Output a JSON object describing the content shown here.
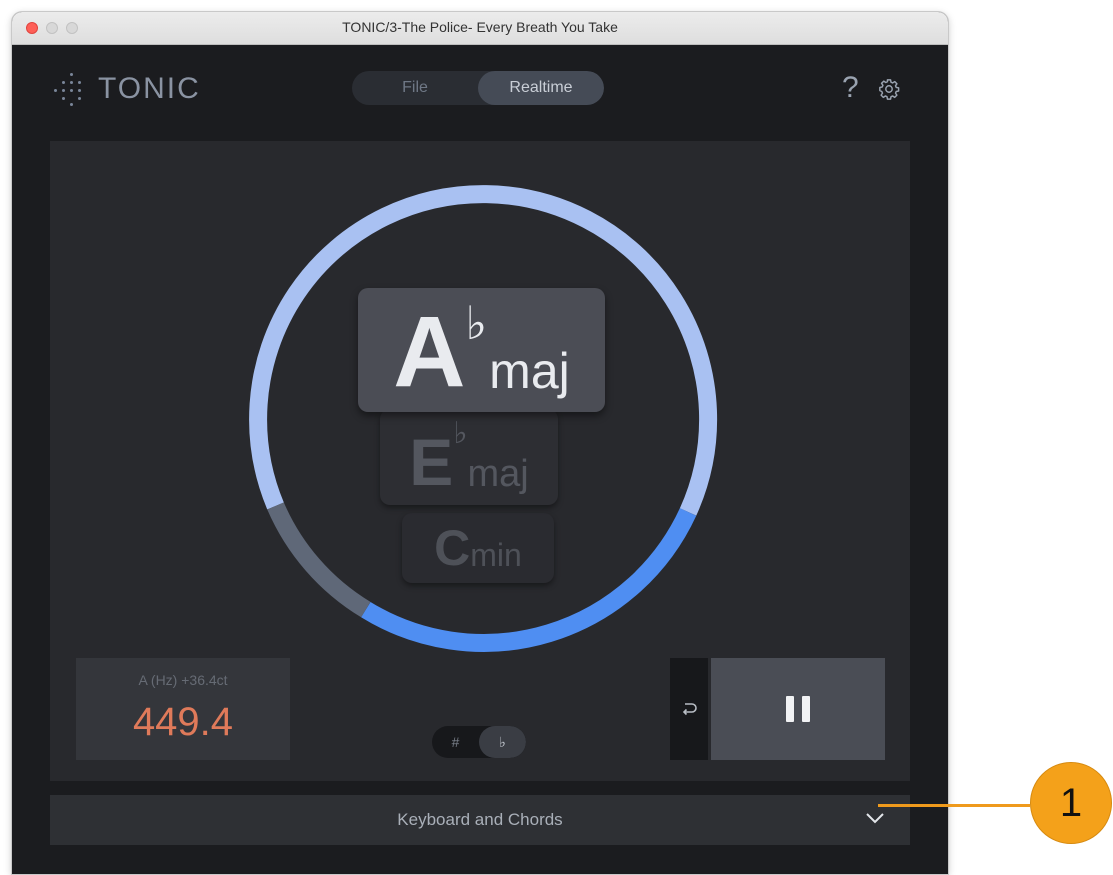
{
  "window": {
    "title": "TONIC/3-The Police- Every Breath You Take"
  },
  "header": {
    "logo_text": "TONIC",
    "modes": [
      {
        "label": "File",
        "active": false
      },
      {
        "label": "Realtime",
        "active": true
      }
    ],
    "help_label": "?"
  },
  "keys": {
    "primary": {
      "root": "A",
      "accidental": "♭",
      "quality": "maj"
    },
    "secondary": {
      "root": "E",
      "accidental": "♭",
      "quality": "maj"
    },
    "tertiary": {
      "root": "C",
      "accidental": "",
      "quality": "min"
    }
  },
  "frequency": {
    "label": "A (Hz)  +36.4ct",
    "value": "449.4"
  },
  "accidentals": {
    "sharp_label": "#",
    "flat_label": "♭",
    "selected": "flat"
  },
  "bottom_panel": {
    "label": "Keyboard and Chords"
  },
  "callout": {
    "number": "1"
  },
  "colors": {
    "ring_light": "#a9c1f2",
    "ring_blue": "#4f8ef2",
    "ring_gray": "#5f6878",
    "frequency_value": "#df7a5a",
    "callout": "#f4a11a"
  },
  "icons": {
    "logo": "dots-grid-icon",
    "help": "question-icon",
    "settings": "gear-icon",
    "reset": "undo-icon",
    "pause": "pause-icon",
    "expand": "chevron-down-icon"
  }
}
